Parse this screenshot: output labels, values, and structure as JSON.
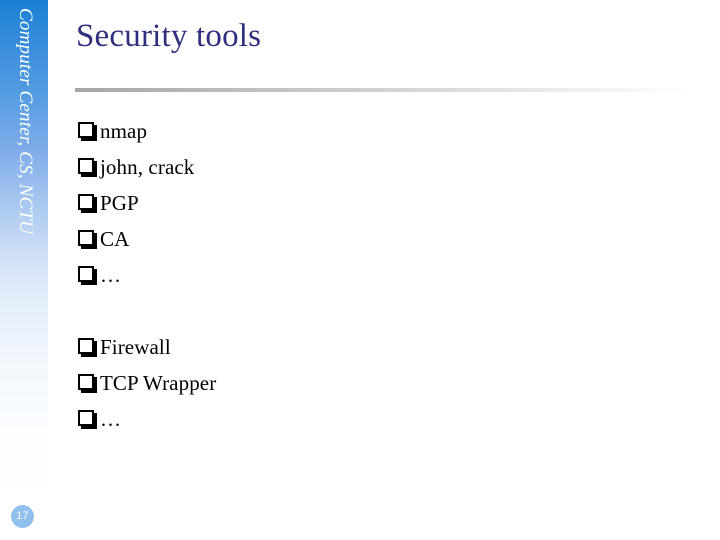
{
  "slide": {
    "title": "Security tools",
    "page_number": "17",
    "sidebar_label": "Computer Center, CS, NCTU",
    "colors": {
      "title": "#2f2f7f",
      "sidebar_top": "#1a7fd4",
      "sidebar_bottom": "#ffffff",
      "badge": "#8fc0ee",
      "divider": "#a6a6a6",
      "body_text": "#000000"
    }
  },
  "content": {
    "groups": [
      {
        "items": [
          {
            "bullet": "square-bullet-icon",
            "label": "nmap"
          },
          {
            "bullet": "square-bullet-icon",
            "label": "john, crack"
          },
          {
            "bullet": "square-bullet-icon",
            "label": "PGP"
          },
          {
            "bullet": "square-bullet-icon",
            "label": "CA"
          },
          {
            "bullet": "square-bullet-icon",
            "label": "…"
          }
        ]
      },
      {
        "items": [
          {
            "bullet": "square-bullet-icon",
            "label": "Firewall"
          },
          {
            "bullet": "square-bullet-icon",
            "label": "TCP Wrapper"
          },
          {
            "bullet": "square-bullet-icon",
            "label": "…"
          }
        ]
      }
    ]
  }
}
